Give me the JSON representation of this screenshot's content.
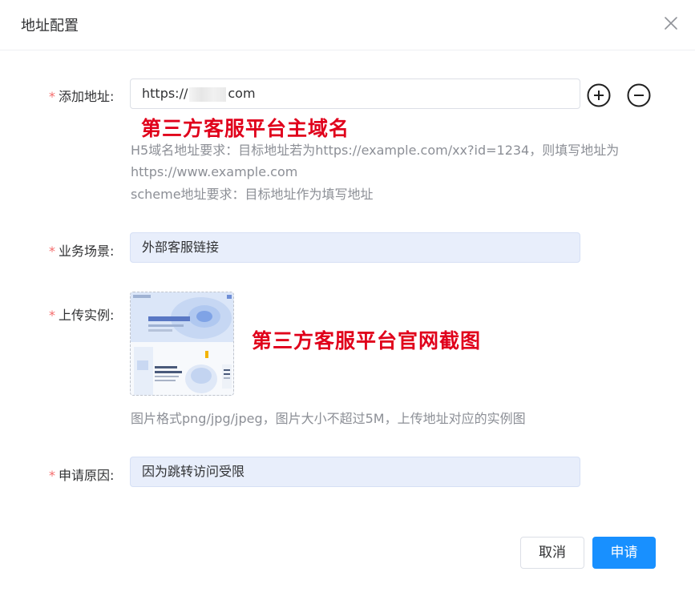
{
  "dialog": {
    "title": "地址配置",
    "close_icon": "close-icon"
  },
  "form": {
    "required_mark": "*",
    "address": {
      "label": "添加地址:",
      "value_prefix": "https://",
      "value_suffix": "com",
      "add_icon": "plus-circle-icon",
      "remove_icon": "minus-circle-icon"
    },
    "annotation_domain": "第三方客服平台主域名",
    "hints": [
      "H5域名地址要求：目标地址若为https://example.com/xx?id=1234，则填写地址为",
      "https://www.example.com",
      "scheme地址要求：目标地址作为填写地址"
    ],
    "scene": {
      "label": "业务场景:",
      "value": "外部客服链接"
    },
    "example": {
      "label": "上传实例:",
      "annotation": "第三方客服平台官网截图",
      "hint": "图片格式png/jpg/jpeg，图片大小不超过5M，上传地址对应的实例图"
    },
    "reason": {
      "label": "申请原因:",
      "value": "因为跳转访问受限"
    }
  },
  "footer": {
    "cancel_label": "取消",
    "submit_label": "申请"
  },
  "colors": {
    "primary": "#1890ff",
    "required": "#f56c6c",
    "annotation_red": "#e0001b",
    "filled_input_bg": "#e8eefb"
  }
}
